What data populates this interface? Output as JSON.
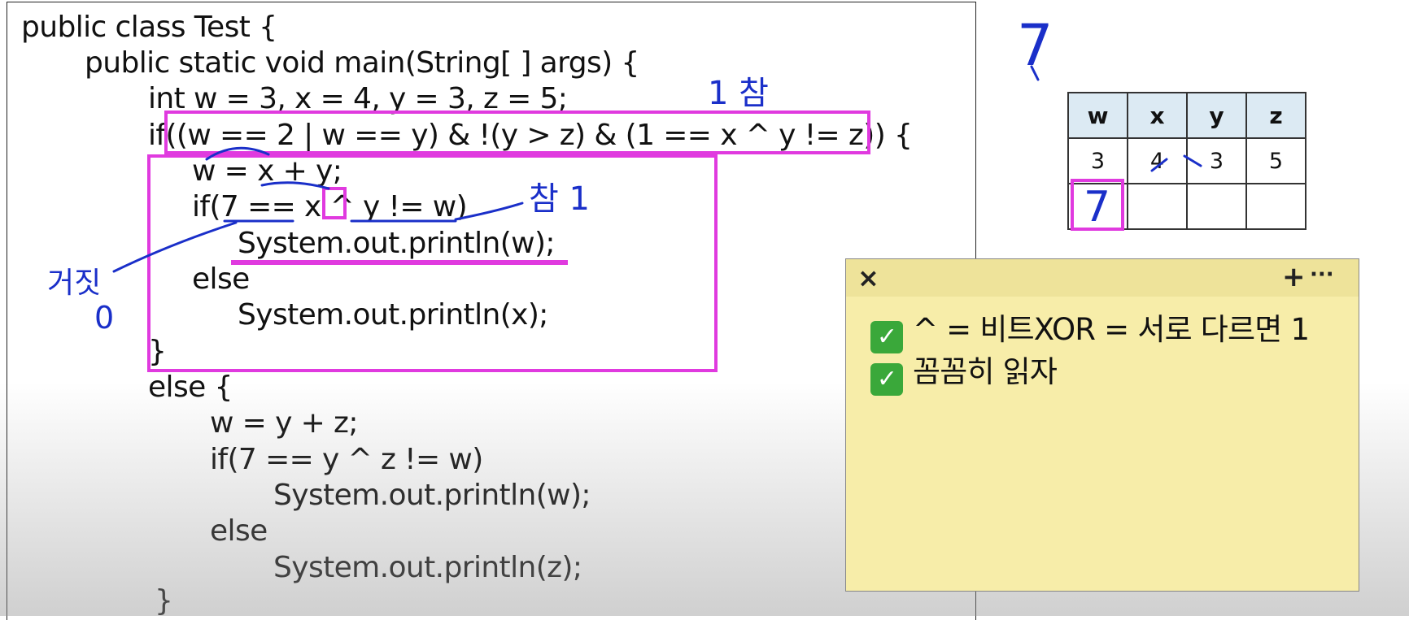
{
  "code": {
    "lines": [
      "public class Test {",
      "public static void main(String[ ] args) {",
      "int w = 3, x = 4, y = 3, z = 5;",
      "if((w == 2 | w == y) & !(y > z) & (1 == x ^ y != z)) {",
      "w = x + y;",
      "if(7 == x ^ y != w)",
      "System.out.println(w);",
      "else",
      "System.out.println(x);",
      "}",
      "else {",
      "w = y + z;",
      "if(7 == y ^ z != w)",
      "System.out.println(w);",
      "else",
      "System.out.println(z);",
      "}"
    ]
  },
  "table": {
    "headers": [
      "w",
      "x",
      "y",
      "z"
    ],
    "row1": [
      "3",
      "4",
      "3",
      "5"
    ],
    "row2": [
      "",
      "",
      "",
      ""
    ]
  },
  "annotations": {
    "top_seven": "7",
    "cond1_label": "1 참",
    "inner_label": "참 1",
    "false_label": "거짓",
    "zero": "0",
    "w_result": "7"
  },
  "sticky_note": {
    "close_icon": "×",
    "add_icon": "+",
    "more_icon": "···",
    "check_glyph": "✓",
    "lines": [
      "^ = 비트XOR = 서로 다르면 1",
      "꼼꼼히 읽자"
    ]
  },
  "colors": {
    "highlight": "#e03adf",
    "pen": "#1a2fc9",
    "note_bg": "#f7eda9",
    "table_header": "#dceaf3"
  }
}
